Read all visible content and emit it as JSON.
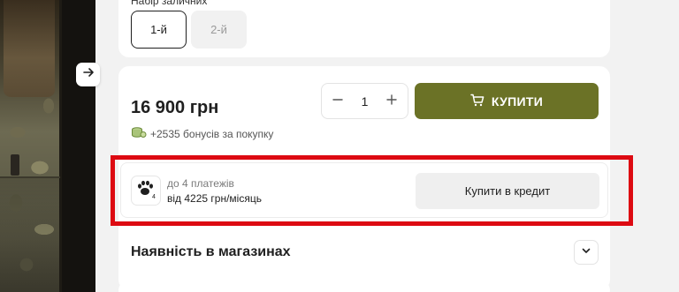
{
  "variants": {
    "label": "Набір заличних",
    "options": [
      {
        "label": "1-й",
        "selected": true
      },
      {
        "label": "2-й",
        "selected": false
      }
    ]
  },
  "product": {
    "price": "16 900 грн",
    "quantity": "1",
    "buy_label": "КУПИТИ",
    "bonus_text": "+2535 бонусів за покупку"
  },
  "credit": {
    "line1": "до 4 платежів",
    "line2": "від 4225 грн/місяць",
    "logo_badge": "4",
    "button_label": "Купити в кредит"
  },
  "stores": {
    "title": "Наявність в магазинах"
  },
  "colors": {
    "accent": "#6b7226",
    "highlight": "#dd0a12"
  },
  "icons": {
    "gallery_next": "arrow-right-icon",
    "decrease": "minus-icon",
    "increase": "plus-icon",
    "buy": "cart-icon",
    "bonus": "coins-icon",
    "credit_logo": "paw-icon",
    "expand": "chevron-down-icon"
  }
}
